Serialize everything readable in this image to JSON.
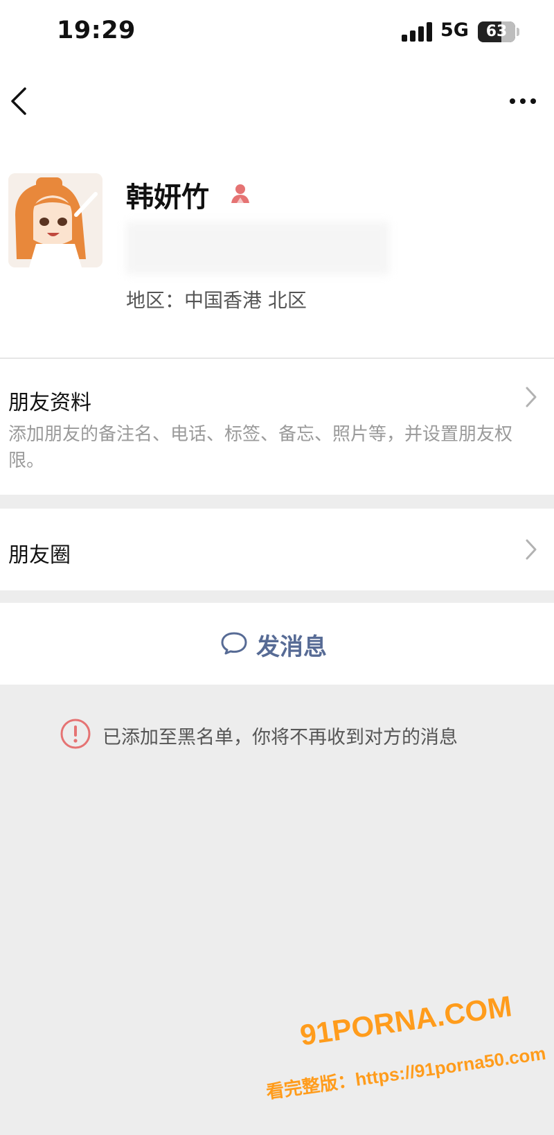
{
  "status_bar": {
    "time": "19:29",
    "network": "5G",
    "battery_level": "63",
    "battery_fraction": 0.63
  },
  "nav": {
    "back_icon": "chevron-left-icon",
    "more_icon": "more-dots-icon"
  },
  "profile": {
    "nickname": "韩妍竹",
    "gender_icon": "female-user-icon",
    "gender_color": "#e57373",
    "region": "地区：中国香港 北区"
  },
  "friend_info": {
    "title": "朋友资料",
    "description": "添加朋友的备注名、电话、标签、备忘、照片等，并设置朋友权限。"
  },
  "moments": {
    "title": "朋友圈"
  },
  "send_message": {
    "label": "发消息",
    "icon": "chat-bubble-icon",
    "color": "#576b95"
  },
  "notice": {
    "icon": "warning-circle-icon",
    "icon_color": "#e57373",
    "text": "已添加至黑名单，你将不再收到对方的消息"
  },
  "watermark": {
    "brand": "91PORNA.COM",
    "url": "看完整版：https://91porna50.com",
    "color": "#ff9c1c"
  }
}
